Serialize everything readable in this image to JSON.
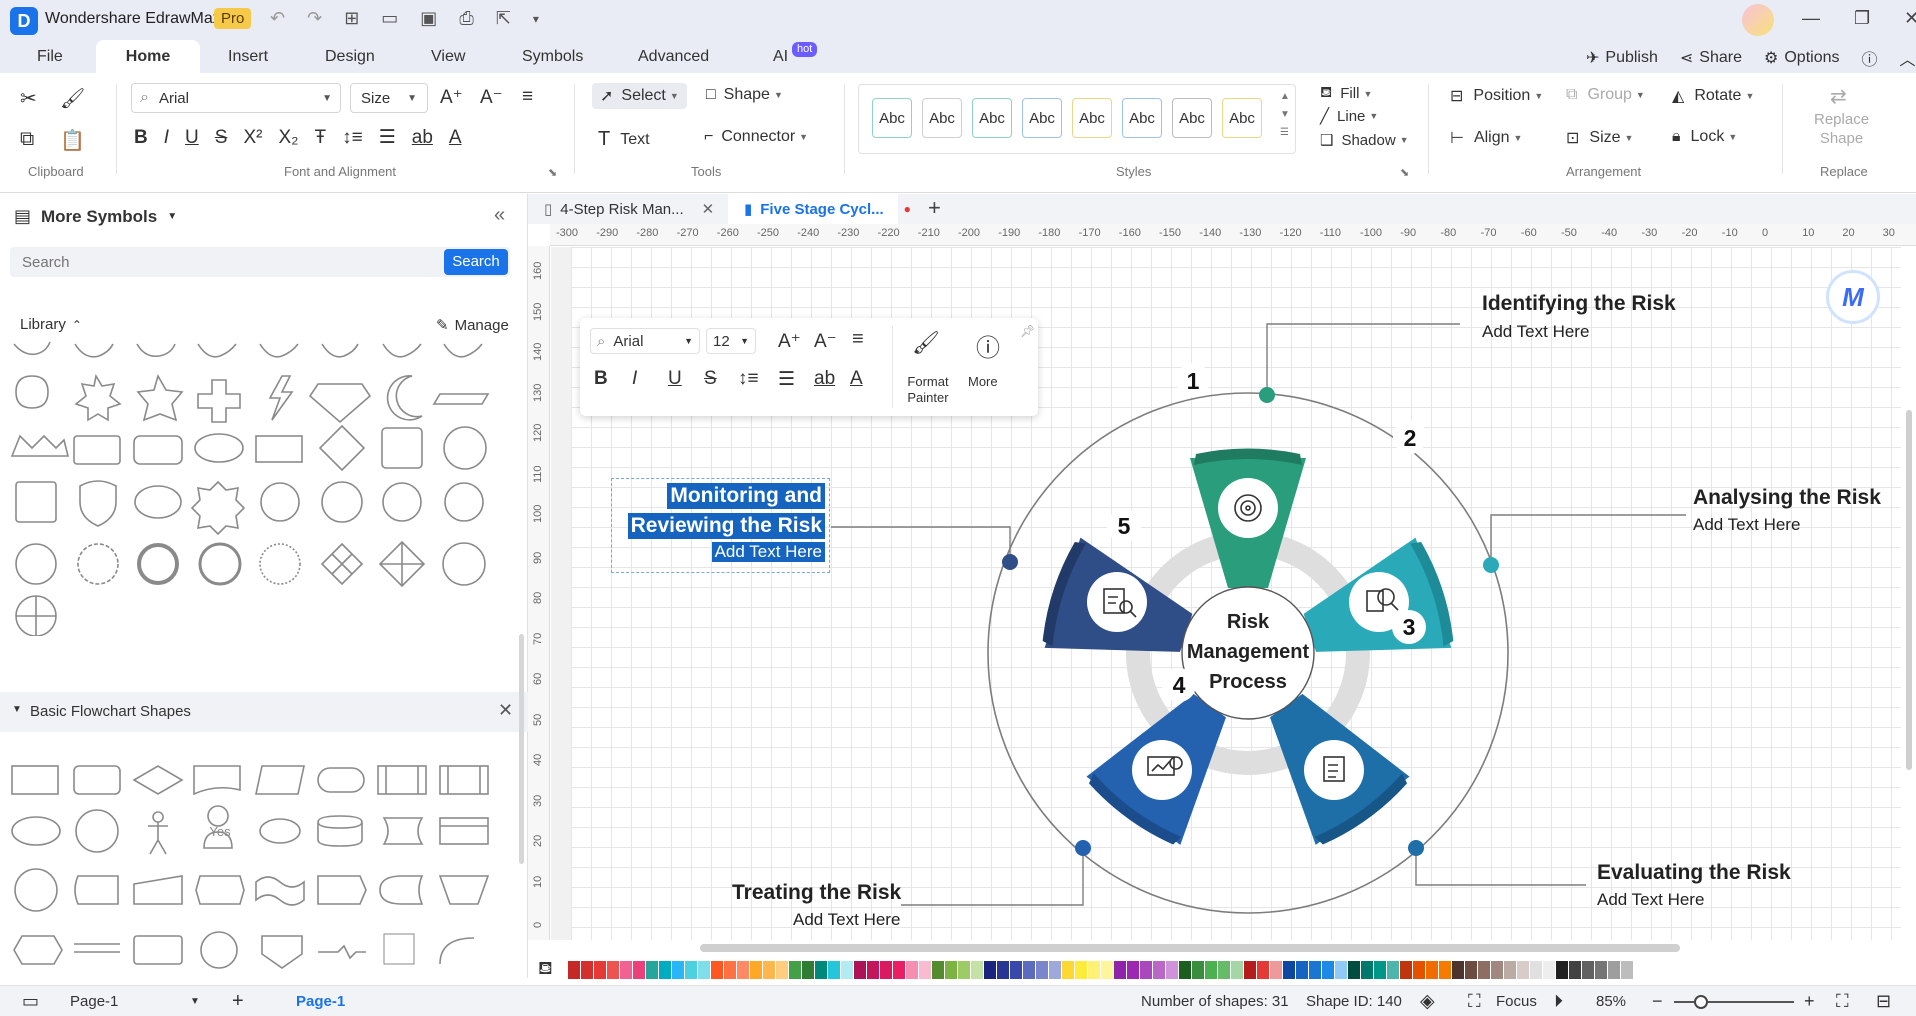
{
  "app": {
    "name": "Wondershare EdrawMax",
    "badge": "Pro"
  },
  "menu": {
    "file": "File",
    "home": "Home",
    "insert": "Insert",
    "design": "Design",
    "view": "View",
    "symbols": "Symbols",
    "advanced": "Advanced",
    "ai": "AI",
    "ai_badge": "hot",
    "publish": "Publish",
    "share": "Share",
    "options": "Options"
  },
  "ribbon": {
    "font": "Arial",
    "size": "Size",
    "select": "Select",
    "shape": "Shape",
    "text": "Text",
    "connector": "Connector",
    "styles": [
      "Abc",
      "Abc",
      "Abc",
      "Abc",
      "Abc",
      "Abc",
      "Abc",
      "Abc"
    ],
    "fill": "Fill",
    "line": "Line",
    "shadow": "Shadow",
    "position": "Position",
    "group": "Group",
    "rotate": "Rotate",
    "align": "Align",
    "lock": "Lock",
    "replace_shape_1": "Replace",
    "replace_shape_2": "Shape",
    "groups": {
      "clipboard": "Clipboard",
      "font": "Font and Alignment",
      "tools": "Tools",
      "styles": "Styles",
      "arrangement": "Arrangement",
      "replace": "Replace"
    }
  },
  "left_panel": {
    "title": "More Symbols",
    "search_placeholder": "Search",
    "search_button": "Search",
    "library": "Library",
    "manage": "Manage",
    "section": "Basic Flowchart Shapes",
    "yes": "Yes"
  },
  "doc_tabs": [
    {
      "label": "4-Step Risk Man..."
    },
    {
      "label": "Five Stage Cycl..."
    }
  ],
  "ruler_top": [
    "-300",
    "-290",
    "-280",
    "-270",
    "-260",
    "-250",
    "-240",
    "-230",
    "-220",
    "-210",
    "-200",
    "-190",
    "-180",
    "-170",
    "-160",
    "-150",
    "-140",
    "-130",
    "-120",
    "-110",
    "-100",
    "-90",
    "-80",
    "-70",
    "-60",
    "-50",
    "-40",
    "-30",
    "-20",
    "-10",
    "0",
    "10",
    "20",
    "30"
  ],
  "ruler_left": [
    "160",
    "150",
    "140",
    "130",
    "120",
    "110",
    "100",
    "90",
    "80",
    "70",
    "60",
    "50",
    "40",
    "30",
    "20",
    "10",
    "0"
  ],
  "float_toolbar": {
    "font": "Arial",
    "size": "12",
    "format_painter_1": "Format",
    "format_painter_2": "Painter",
    "more": "More"
  },
  "diagram": {
    "center": [
      "Risk",
      "Management",
      "Process"
    ],
    "numbers": [
      "1",
      "2",
      "3",
      "4",
      "5"
    ],
    "steps": [
      {
        "title": "Identifying the Risk",
        "sub": "Add Text Here"
      },
      {
        "title": "Analysing the Risk",
        "sub": "Add Text Here"
      },
      {
        "title": "Evaluating the Risk",
        "sub": "Add Text Here"
      },
      {
        "title": "Treating the Risk",
        "sub": "Add Text Here"
      },
      {
        "title_1": "Monitoring and",
        "title_2": "Reviewing the Risk",
        "sub": "Add Text Here"
      }
    ],
    "colors": {
      "s1": "#2a9d7c",
      "s2": "#2aa9b8",
      "s3": "#1e6ea8",
      "s4": "#2462b0",
      "s5": "#2f4d86",
      "ring": "#dcdcdc",
      "selection": "#1565c0"
    }
  },
  "status": {
    "page_tab": "Page-1",
    "page_active": "Page-1",
    "shapes": "Number of shapes: 31",
    "shape_id": "Shape ID: 140",
    "focus": "Focus",
    "zoom": "85%"
  }
}
